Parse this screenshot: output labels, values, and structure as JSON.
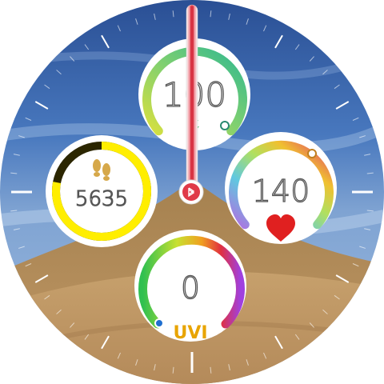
{
  "watch": {
    "complications": {
      "battery": {
        "value": "100",
        "level": 100,
        "icon": "charging-bolt-icon"
      },
      "steps": {
        "value": "5635",
        "progress": 0.78,
        "icon": "footsteps-icon"
      },
      "heart_rate": {
        "value": "140",
        "icon": "heart-icon"
      },
      "uv_index": {
        "value": "0",
        "label": "UVI"
      }
    },
    "center_icon": "bluetooth-icon",
    "colors": {
      "hand": "#e0505a",
      "steps_ring": "#ffee00",
      "steps_track": "#2b2600",
      "heart": "#e02020",
      "uvi_label": "#e8a400",
      "sky": "#3d6ab0",
      "dune": "#b08858"
    }
  }
}
